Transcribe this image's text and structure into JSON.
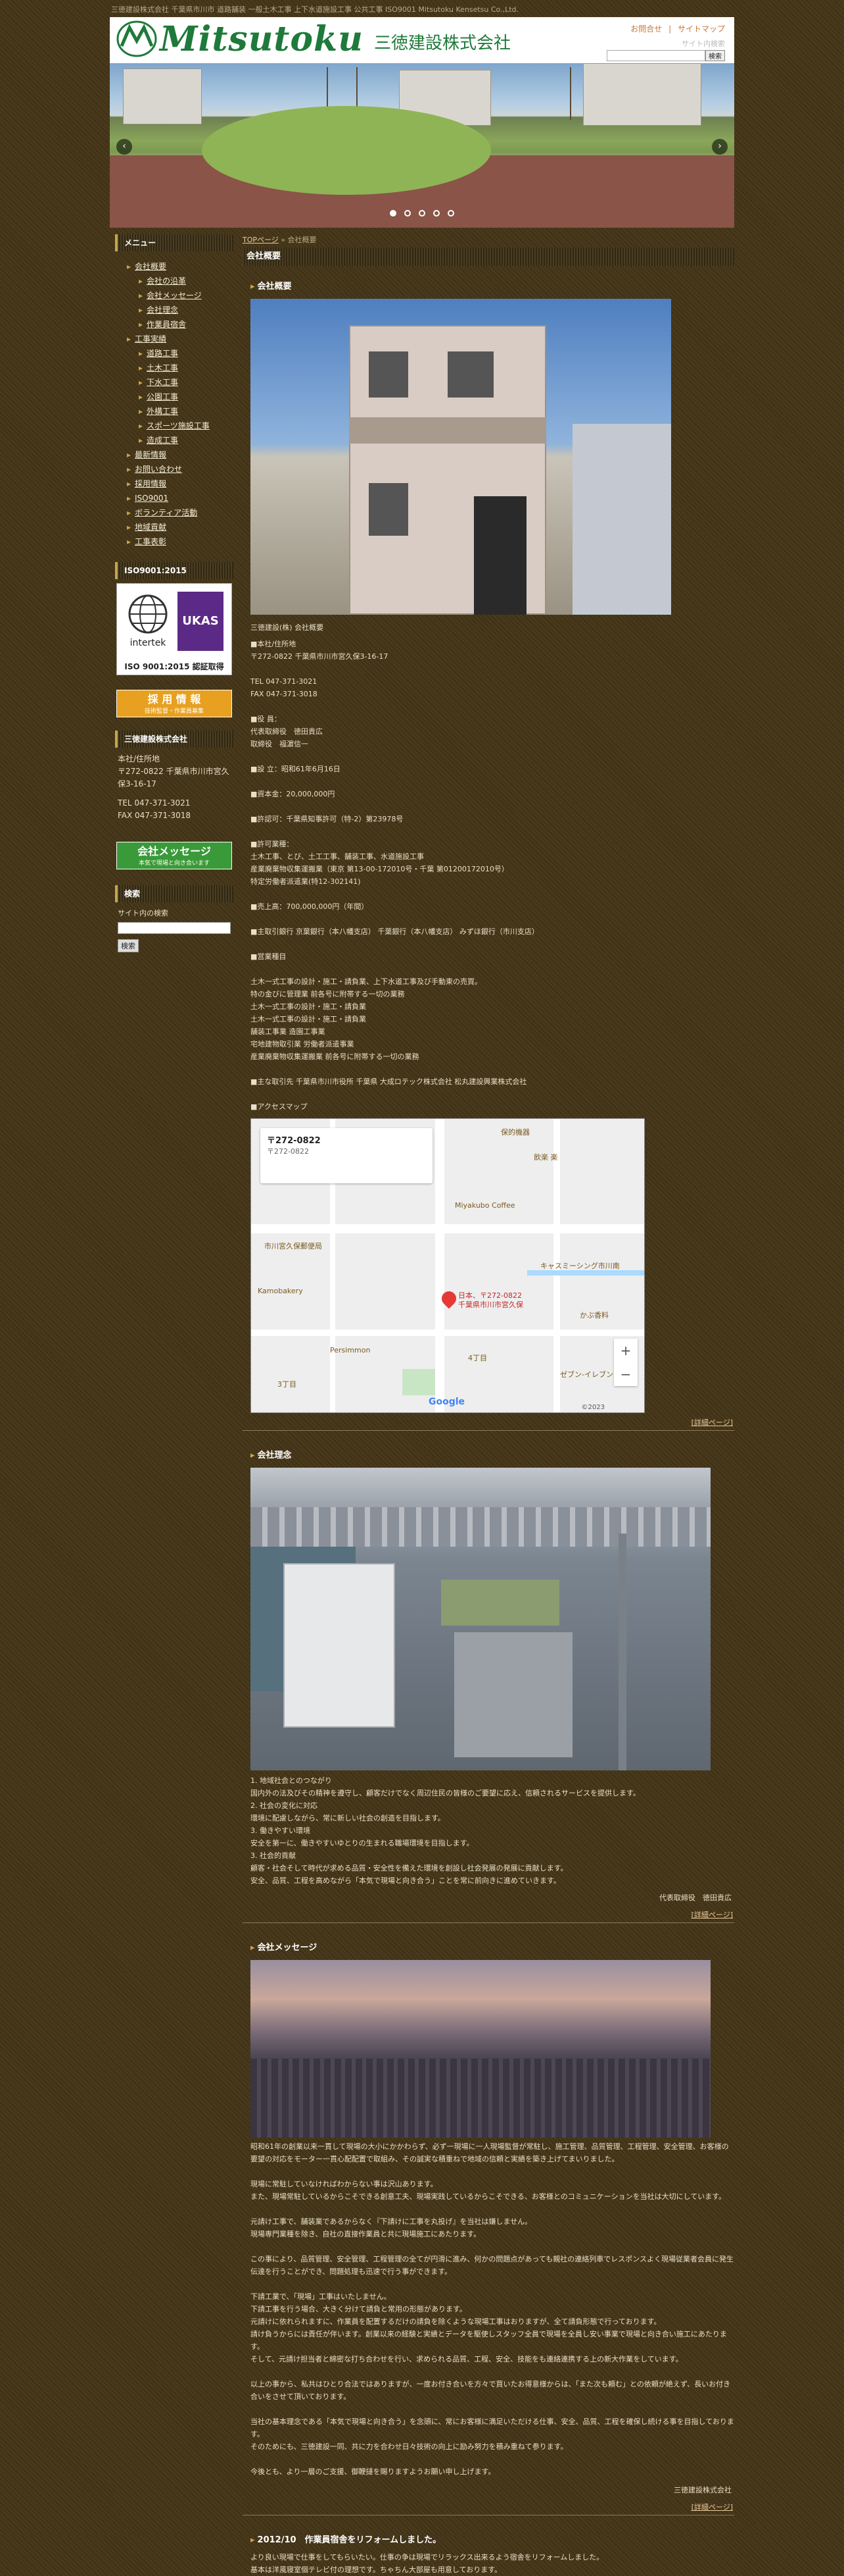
{
  "topline": "三徳建設株式会社 千葉県市川市 道路舗装 一般土木工事 上下水道施設工事 公共工事 ISO9001 Mitsutoku Kensetsu Co.,Ltd.",
  "header": {
    "logo_text": "Mitsutoku",
    "logo_kanji": "三徳建設株式会社",
    "links": [
      "お問合せ",
      "|",
      "サイトマップ"
    ],
    "site_search_label": "サイト内検索",
    "search_button": "検索"
  },
  "slider": {
    "prev": "‹",
    "next": "›",
    "dots": 5,
    "active_dot": 0
  },
  "sidebar": {
    "menu_title": "メニュー",
    "menu": [
      {
        "label": "会社概要",
        "sub": false
      },
      {
        "label": "会社の沿革",
        "sub": true
      },
      {
        "label": "会社メッセージ",
        "sub": true
      },
      {
        "label": "会社理念",
        "sub": true
      },
      {
        "label": "作業員宿舎",
        "sub": true
      },
      {
        "label": "工事実績",
        "sub": false
      },
      {
        "label": "道路工事",
        "sub": true
      },
      {
        "label": "土木工事",
        "sub": true
      },
      {
        "label": "下水工事",
        "sub": true
      },
      {
        "label": "公園工事",
        "sub": true
      },
      {
        "label": "外構工事",
        "sub": true
      },
      {
        "label": "スポーツ施設工事",
        "sub": true
      },
      {
        "label": "造成工事",
        "sub": true
      },
      {
        "label": "最新情報",
        "sub": false
      },
      {
        "label": "お問い合わせ",
        "sub": false
      },
      {
        "label": "採用情報",
        "sub": false
      },
      {
        "label": "ISO9001",
        "sub": false
      },
      {
        "label": "ボランティア活動",
        "sub": false
      },
      {
        "label": "地域貢献",
        "sub": false
      },
      {
        "label": "工事表彰",
        "sub": false
      }
    ],
    "iso_title": "ISO9001:2015",
    "iso_caption": "ISO 9001:2015 認証取得",
    "iso_logo1": "intertek",
    "iso_logo2": "UKAS",
    "recruit_main": "採 用 情 報",
    "recruit_sub": "技術監督・作業員募集",
    "company_title": "三徳建設株式会社",
    "address_lines": [
      "本社/住所地",
      "〒272-0822 千葉県市川市宮久保3-16-17",
      "",
      "TEL 047-371-3021",
      "FAX 047-371-3018"
    ],
    "message_main": "会社メッセージ",
    "message_sub": "本気で現場と向き合います",
    "search_title": "検索",
    "search_label": "サイト内の検索",
    "search_button": "検索"
  },
  "main": {
    "breadcrumb_link": "TOPページ",
    "breadcrumb_sep": "»",
    "breadcrumb_current": "会社概要",
    "page_title": "会社概要",
    "sections": [
      {
        "title": "会社概要",
        "caption": "三徳建設(株) 会社概要",
        "body": "■本社/住所地\n〒272-0822 千葉県市川市宮久保3-16-17\n\nTEL 047-371-3021\nFAX 047-371-3018\n\n■役 員：\n代表取締役　徳田貴広\n取締役　福濵信一\n\n■設 立：昭和61年6月16日\n\n■資本金：20,000,000円\n\n■許認可：千葉県知事許可（特-2）第23978号\n\n■許可業種：\n土木工事、とび、土工工事、舗装工事、水道施設工事\n産業廃棄物収集運搬業（東京 第13-00-172010号・千葉 第01200172010号）\n特定労働者派遣業(特12-302141)\n\n■売上高：700,000,000円（年間）\n\n■主取引銀行 京葉銀行（本八幡支店） 千葉銀行（本八幡支店） みずほ銀行（市川支店）\n\n■営業種目\n\n土木一式工事の設計・施工・請負業、上下水道工事及び手動東の売買。\n特の金びに管理業 前各号に附帯する一切の業務\n土木一式工事の設計・施工・請負業\n土木一式工事の設計・施工・請負業\n舗装工事業 造園工事業\n宅地建物取引業 労働者派遣事業\n産業廃棄物収集運搬業 前各号に附帯する一切の業務\n\n■主な取引先 千葉県市川市役所 千葉県 大成ロテック株式会社 松丸建設興業株式会社\n\n■アクセスマップ",
        "more": "[詳細ページ]"
      },
      {
        "title": "会社理念",
        "body": "1. 地域社会とのつながり\n国内外の法及びその精神を遵守し、顧客だけでなく周辺住民の皆様のご要望に応え、信頼されるサービスを提供します。\n2. 社会の変化に対応\n環境に配慮しながら、常に新しい社会の創造を目指します。\n3. 働きやすい環境\n安全を第一に、働きやすいゆとりの生まれる職場環境を目指します。\n3. 社会的貢献\n顧客・社会そして時代が求める品質・安全性を備えた環境を創設し社会発展の発展に貢献します。\n安全、品質、工程を高めながら「本気で現場と向き合う」ことを常に前向きに進めていきます。",
        "signature": "代表取締役　徳田貴広",
        "more": "[詳細ページ]"
      },
      {
        "title": "会社メッセージ",
        "body": "昭和61年の創業以来一貫して現場の大小にかかわらず、必ず一現場に一人現場監督が常駐し、施工管理、品質管理、工程管理、安全管理、お客様の要望の対応をモーター一貫心配配置で取組み、その誠実な積重ねで地域の信頼と実績を築き上げてまいりました。\n\n現場に常駐していなければわからない事は沢山あります。\nまた、現場常駐しているからこそできる創意工夫、現場実践しているからこそできる、お客様とのコミュニケーションを当社は大切にしています。\n\n元請け工事で、舗装業であるからなく『下請けに工事を丸投げ』を当社は嫌しません。\n現場専門業種を除き、自社の直接作業員と共に現場施工にあたります。\n\nこの事により、品質管理、安全管理、工程管理の全てが円滑に進み、何かの問題点があっても親社の連絡列車でレスポンスよく現場従業者会員に発生伝達を行うことができ、問題処理も迅速で行う事ができます。\n\n下請工業で、「現場」工事はいたしません。\n下請工事を行う場合、大きく分けて請負と常用の形態があります。\n元請けに依れられますに、作業員を配置するだけの請負を除くような現場工事はおりますが、全て請負形態で行っております。\n請け負うからには責任が伴います。創業以来の経験と実績とデータを駆使しスタッフ全員で現場を全員し安い事業で現場と向き合い施工にあたります。\nそして、元請け担当者と綿密な打ち合わせを行い、求められる品質、工程、安全、技能をも連絡連携する上の新大作業をしています。\n\n以上の事から、私共はひとり合法ではありますが、一度お付き合いを方々で買いたお得意様からは、「また次も頼む」との依頼が絶えず、長いお付き合いをさせて頂いております。\n\n当社の基本理念である「本気で現場と向き合う」を念頭に、常にお客様に満足いただける仕事、安全、品質、工程を確保し続ける事を目指しております。\nそのためにも、三徳建設一同、共に力を合わせ日々技術の向上に励み努力を積み重ねて参ります。\n\n今後とも、より一層のご支援、御鞭撻を賜りますようお願い申し上げます。",
        "signature": "三徳建設株式会社",
        "more": "[詳細ページ]"
      },
      {
        "title": "2012/10　作業員宿舎をリフォームしました。",
        "body": "より良い現場で仕事をしてもらいたい。仕事の争は現場でリラックス出来るよう宿舎をリフォームしました。\n基本は洋風寝室個テレビ付の理想です。ちゃちん大部屋も用意しております。"
      }
    ],
    "map": {
      "card_title": "〒272-0822",
      "card_sub": "〒272-0822",
      "pin_label": "日本、〒272-0822\n千葉県市川市宮久保",
      "zoom_in": "+",
      "zoom_out": "−",
      "google": "Google",
      "copyright": "©2023",
      "pois": [
        "保的機器",
        "飲楽 楽",
        "Miyakubo Coffee",
        "市川宮久保郵便局",
        "Kamobakery",
        "キャスミーシング市川南",
        "Persimmon",
        "かぶ香料",
        "4丁目",
        "3丁目",
        "ゼブン-イレブン"
      ]
    }
  },
  "colors": {
    "accent": "#c9a54a",
    "brand_green": "#1e7a3a",
    "background": "#4a3a1c"
  }
}
